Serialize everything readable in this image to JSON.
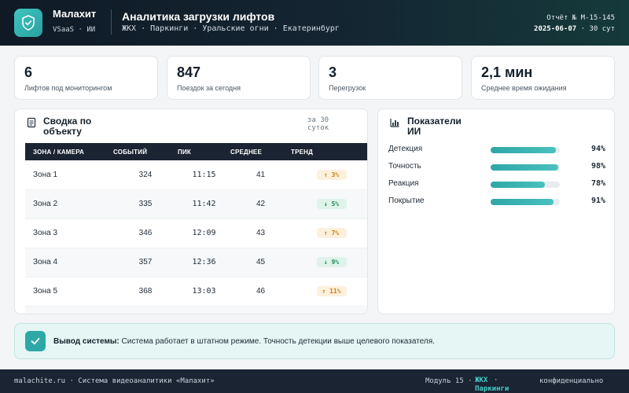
{
  "app": {
    "name": "Малахит",
    "subtitle": "VSaaS · ИИ"
  },
  "header": {
    "title": "Аналитика загрузки лифтов",
    "breadcrumb": "ЖКХ · Паркинги · Уральские огни · Екатеринбург",
    "report_number": "Отчёт № M-15-145",
    "report_date": "2025-06-07",
    "report_period": "· 30 сут"
  },
  "kpis": [
    {
      "value": "6",
      "label": "Лифтов под мониторингом"
    },
    {
      "value": "847",
      "label": "Поездок за сегодня"
    },
    {
      "value": "3",
      "label": "Перегрузок"
    },
    {
      "value": "2,1 мин",
      "label": "Среднее время ожидания"
    }
  ],
  "summary": {
    "title": "Сводка по объекту",
    "period": "за 30 суток",
    "columns": [
      "ЗОНА / КАМЕРА",
      "СОБЫТИЙ",
      "ПИК",
      "СРЕДНЕЕ",
      "ТРЕНД"
    ],
    "rows": [
      {
        "zone": "Зона 1",
        "events": "324",
        "peak": "11:15",
        "avg": "41",
        "trend": "↑ 3%",
        "dir": "up"
      },
      {
        "zone": "Зона 2",
        "events": "335",
        "peak": "11:42",
        "avg": "42",
        "trend": "↓ 5%",
        "dir": "down"
      },
      {
        "zone": "Зона 3",
        "events": "346",
        "peak": "12:09",
        "avg": "43",
        "trend": "↑ 7%",
        "dir": "up"
      },
      {
        "zone": "Зона 4",
        "events": "357",
        "peak": "12:36",
        "avg": "45",
        "trend": "↓ 9%",
        "dir": "down"
      },
      {
        "zone": "Зона 5",
        "events": "368",
        "peak": "13:03",
        "avg": "46",
        "trend": "↑ 11%",
        "dir": "up"
      }
    ]
  },
  "ai": {
    "title": "Показатели ИИ",
    "metrics": [
      {
        "label": "Детекция",
        "value": "94%",
        "fraction": 0.94
      },
      {
        "label": "Точность",
        "value": "98%",
        "fraction": 0.98
      },
      {
        "label": "Реакция",
        "value": "78%",
        "fraction": 0.78
      },
      {
        "label": "Покрытие",
        "value": "91%",
        "fraction": 0.91
      }
    ]
  },
  "system_output": {
    "label": "Вывод системы:",
    "text": "Система работает в штатном режиме. Точность детекции выше целевого показателя."
  },
  "footer": {
    "left": "malachite.ru · Система видеоаналитики «Малахит»",
    "module": "Модуль 15 ·",
    "tag": "ЖКХ Паркинги",
    "sep": "·",
    "conf": "конфиденциально"
  },
  "colors": {
    "accent": "#2ea7a7",
    "header_dark": "#0f1a26",
    "trend_up": "#c98110",
    "trend_down": "#1f8a5a"
  }
}
